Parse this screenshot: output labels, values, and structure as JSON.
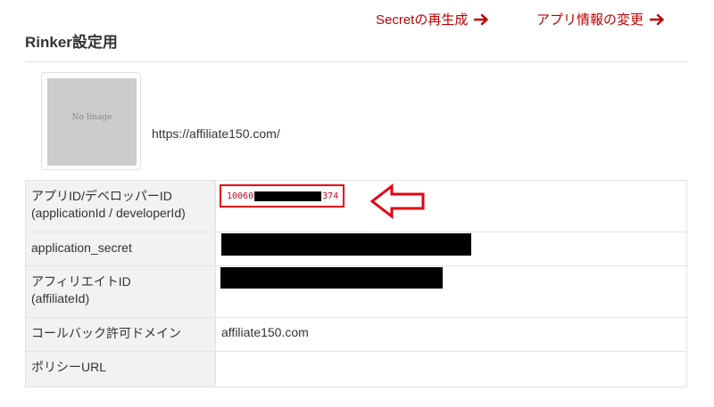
{
  "header": {
    "title": "Rinker設定用",
    "regen_secret_label": "Secretの再生成",
    "change_app_info_label": "アプリ情報の変更",
    "accent_color": "#bf0000"
  },
  "app": {
    "thumbnail_text": "No Image",
    "url": "https://affiliate150.com/"
  },
  "table": {
    "rows": [
      {
        "label": "アプリID/デベロッパーID\n(applicationId / developerId)",
        "value_prefix": "10060",
        "value_suffix": "374"
      },
      {
        "label": "application_secret",
        "value": ""
      },
      {
        "label": "アフィリエイトID\n(affiliateId)",
        "value": ""
      },
      {
        "label": "コールバック許可ドメイン",
        "value": "affiliate150.com"
      },
      {
        "label": "ポリシーURL",
        "value": ""
      }
    ]
  },
  "annotations": {
    "highlight_color": "#e60012",
    "pointer": "left-arrow-outline"
  },
  "icons": {
    "header_link_arrow": "arrow-right-icon",
    "pointer_arrow": "arrow-left-outline-icon"
  }
}
